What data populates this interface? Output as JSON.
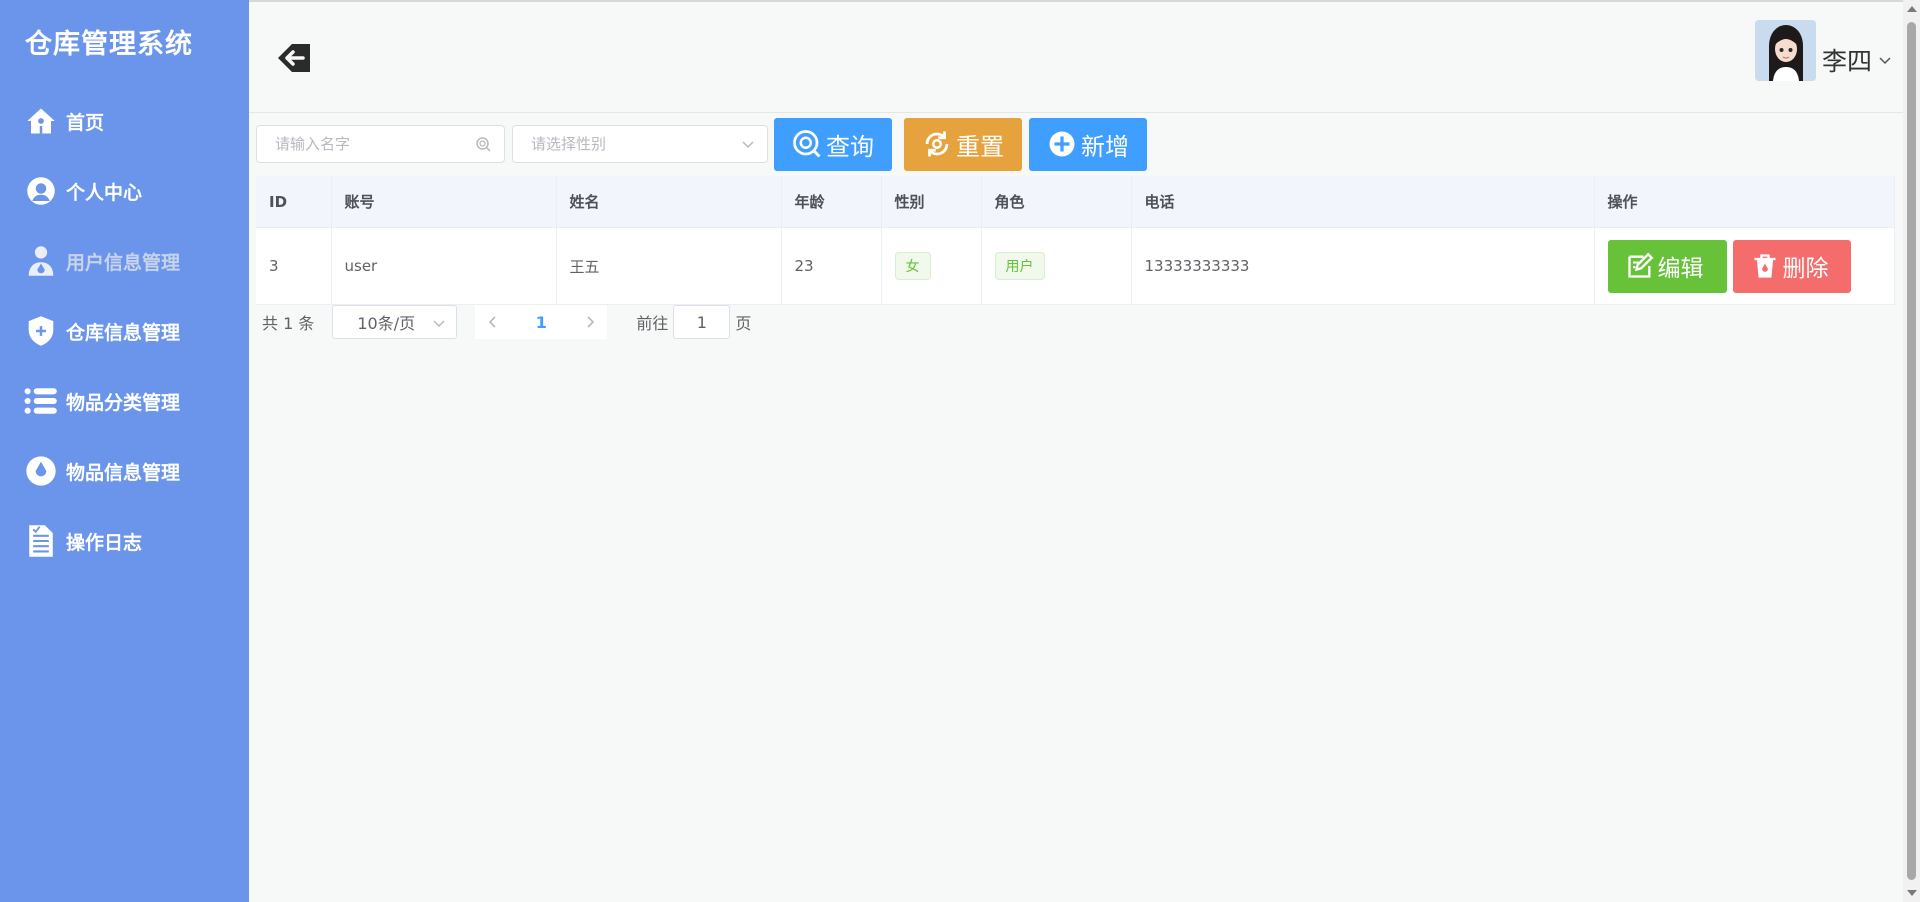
{
  "app": {
    "title": "仓库管理系统"
  },
  "sidebar": {
    "items": [
      {
        "label": "首页",
        "icon": "home-icon"
      },
      {
        "label": "个人中心",
        "icon": "user-circle-icon"
      },
      {
        "label": "用户信息管理",
        "icon": "user-drop-icon",
        "active": true
      },
      {
        "label": "仓库信息管理",
        "icon": "shield-icon"
      },
      {
        "label": "物品分类管理",
        "icon": "list-icon"
      },
      {
        "label": "物品信息管理",
        "icon": "drop-icon"
      },
      {
        "label": "操作日志",
        "icon": "document-icon"
      }
    ]
  },
  "header": {
    "user_name": "李四"
  },
  "toolbar": {
    "name_placeholder": "请输入名字",
    "gender_placeholder": "请选择性别",
    "query_label": "查询",
    "reset_label": "重置",
    "add_label": "新增"
  },
  "table": {
    "columns": [
      "ID",
      "账号",
      "姓名",
      "年龄",
      "性别",
      "角色",
      "电话",
      "操作"
    ],
    "rows": [
      {
        "id": "3",
        "account": "user",
        "name": "王五",
        "age": "23",
        "gender": "女",
        "role": "用户",
        "phone": "13333333333"
      }
    ],
    "edit_label": "编辑",
    "delete_label": "删除"
  },
  "pagination": {
    "total_text": "共 1 条",
    "page_size": "10条/页",
    "current_page": "1",
    "goto_prefix": "前往",
    "goto_value": "1",
    "goto_suffix": "页"
  },
  "colors": {
    "sidebar": "#6a95ea",
    "primary": "#409eff",
    "warning": "#e6a23c",
    "success": "#67c23a",
    "danger": "#f56c6c"
  }
}
